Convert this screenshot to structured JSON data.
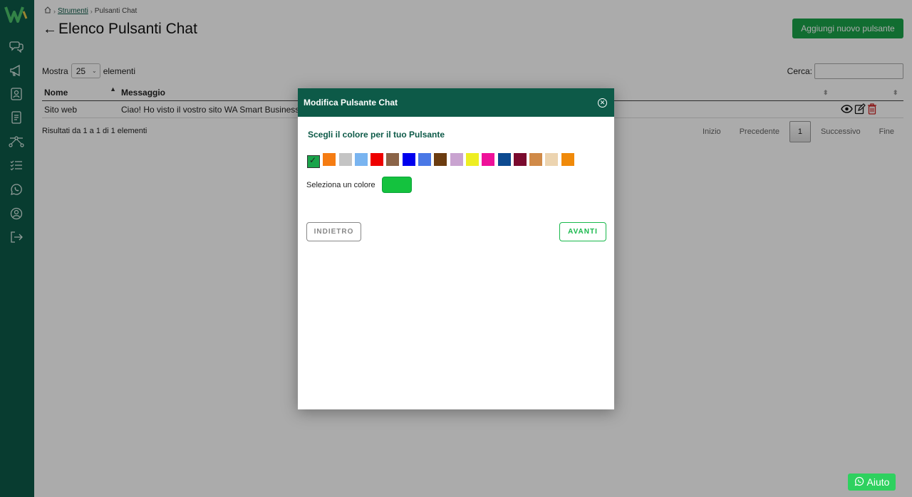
{
  "breadcrumb": {
    "link": "Strumenti",
    "current": "Pulsanti Chat"
  },
  "page": {
    "title": "Elenco Pulsanti Chat",
    "add_button": "Aggiungi nuovo pulsante"
  },
  "controls": {
    "show_label": "Mostra",
    "show_value": "25",
    "show_suffix": "elementi",
    "search_label": "Cerca:"
  },
  "table": {
    "columns": [
      "Nome",
      "Messaggio"
    ],
    "rows": [
      {
        "nome": "Sito web",
        "messaggio": "Ciao! Ho visto il vostro sito WA Smart Business"
      }
    ]
  },
  "results_info": "Risultati da 1 a 1 di 1 elementi",
  "pagination": {
    "first": "Inizio",
    "prev": "Precedente",
    "current": "1",
    "next": "Successivo",
    "last": "Fine"
  },
  "modal": {
    "title": "Modifica Pulsante Chat",
    "subtitle": "Scegli il colore per il tuo Pulsante",
    "swatch_colors": [
      "#1aa34a",
      "#f57c12",
      "#c4c4c4",
      "#79b4f0",
      "#ee0000",
      "#8b6448",
      "#0000ee",
      "#4a78e6",
      "#6b3c10",
      "#c9a3d0",
      "#eeee22",
      "#ee1199",
      "#0d4a90",
      "#7a0a2e",
      "#d08a48",
      "#ecd4b0",
      "#f08a0a"
    ],
    "selected_index": 0,
    "color_label": "Seleziona un colore",
    "selected_color": "#14c23e",
    "back_button": "INDIETRO",
    "next_button": "AVANTI"
  },
  "help_button": "Aiuto"
}
